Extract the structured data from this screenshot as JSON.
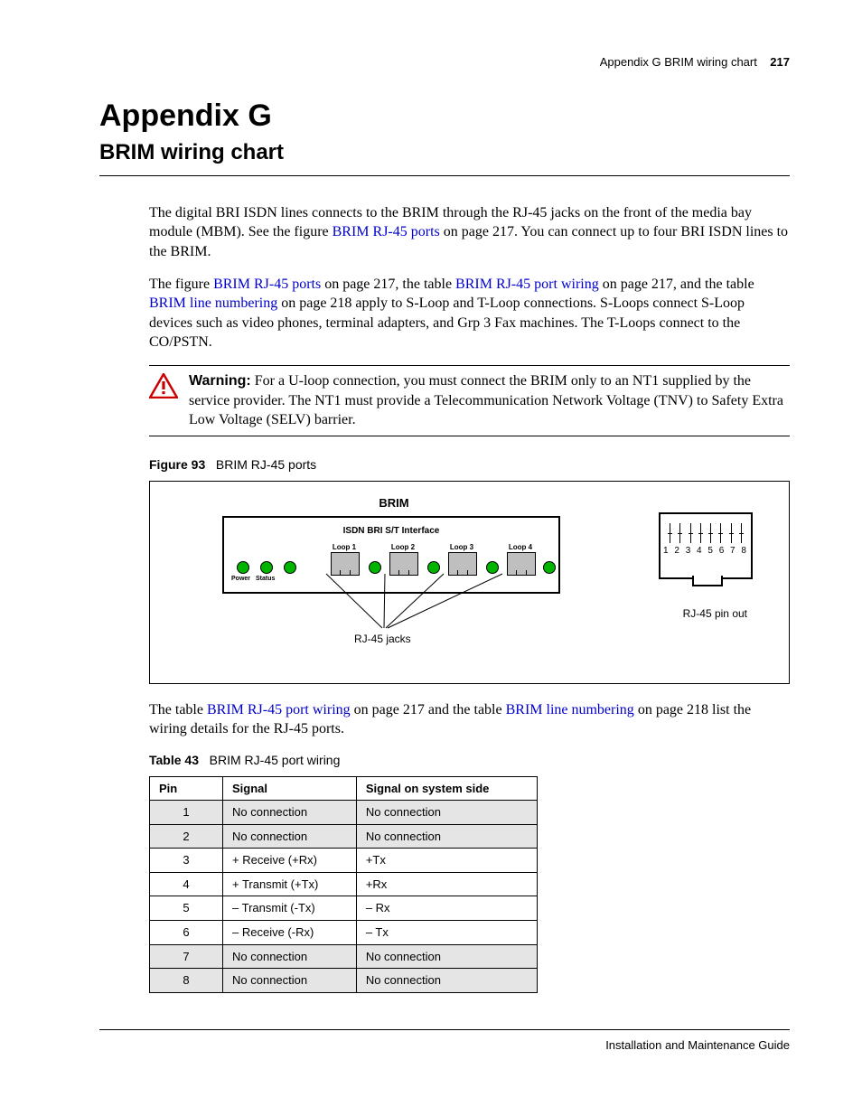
{
  "header": {
    "breadcrumb": "Appendix G  BRIM wiring chart",
    "page_number": "217"
  },
  "title": {
    "appendix": "Appendix G",
    "subtitle": "BRIM wiring chart"
  },
  "para1": {
    "a": "The digital BRI ISDN lines connects to the BRIM through the RJ-45 jacks on the front of the media bay module (MBM). See the figure ",
    "link1": "BRIM RJ-45 ports",
    "b": " on page 217. You can connect up to four BRI ISDN lines to the BRIM."
  },
  "para2": {
    "a": "The figure ",
    "link1": "BRIM RJ-45 ports",
    "b": " on page 217, the table ",
    "link2": "BRIM RJ-45 port wiring",
    "c": " on page 217, and the table ",
    "link3": "BRIM line numbering",
    "d": " on page 218 apply to S-Loop and T-Loop connections. S-Loops connect S-Loop devices such as video phones, terminal adapters, and Grp 3 Fax machines. The T-Loops connect to the CO/PSTN."
  },
  "warning": {
    "label": "Warning:",
    "text": " For a U-loop connection, you must connect the BRIM only to an NT1 supplied by the service provider. The NT1 must provide a Telecommunication Network Voltage (TNV) to Safety Extra Low Voltage (SELV) barrier."
  },
  "figure": {
    "label": "Figure 93",
    "caption": "BRIM RJ-45 ports",
    "brim_title": "BRIM",
    "isdn": "ISDN BRI S/T Interface",
    "loops": [
      "Loop 1",
      "Loop 2",
      "Loop 3",
      "Loop 4"
    ],
    "power": "Power",
    "status": "Status",
    "jacks_label": "RJ-45 jacks",
    "pinout_label": "RJ-45 pin out",
    "pin_nums": "1 2 3 4 5 6 7 8"
  },
  "para3": {
    "a": "The table ",
    "link1": "BRIM RJ-45 port wiring",
    "b": " on page 217 and the table ",
    "link2": "BRIM line numbering",
    "c": " on page 218 list the wiring details for the RJ-45 ports."
  },
  "table": {
    "label": "Table 43",
    "caption": "BRIM RJ-45 port wiring",
    "headers": [
      "Pin",
      "Signal",
      "Signal on system side"
    ],
    "rows": [
      {
        "pin": "1",
        "signal": "No connection",
        "system": "No connection",
        "shade": true
      },
      {
        "pin": "2",
        "signal": "No connection",
        "system": "No connection",
        "shade": true
      },
      {
        "pin": "3",
        "signal": "+ Receive (+Rx)",
        "system": "+Tx",
        "shade": false
      },
      {
        "pin": "4",
        "signal": "+ Transmit (+Tx)",
        "system": "+Rx",
        "shade": false
      },
      {
        "pin": "5",
        "signal": "– Transmit (-Tx)",
        "system": "– Rx",
        "shade": false
      },
      {
        "pin": "6",
        "signal": "– Receive (-Rx)",
        "system": "– Tx",
        "shade": false
      },
      {
        "pin": "7",
        "signal": "No connection",
        "system": "No connection",
        "shade": true
      },
      {
        "pin": "8",
        "signal": "No connection",
        "system": "No connection",
        "shade": true
      }
    ]
  },
  "footer": "Installation and Maintenance Guide"
}
